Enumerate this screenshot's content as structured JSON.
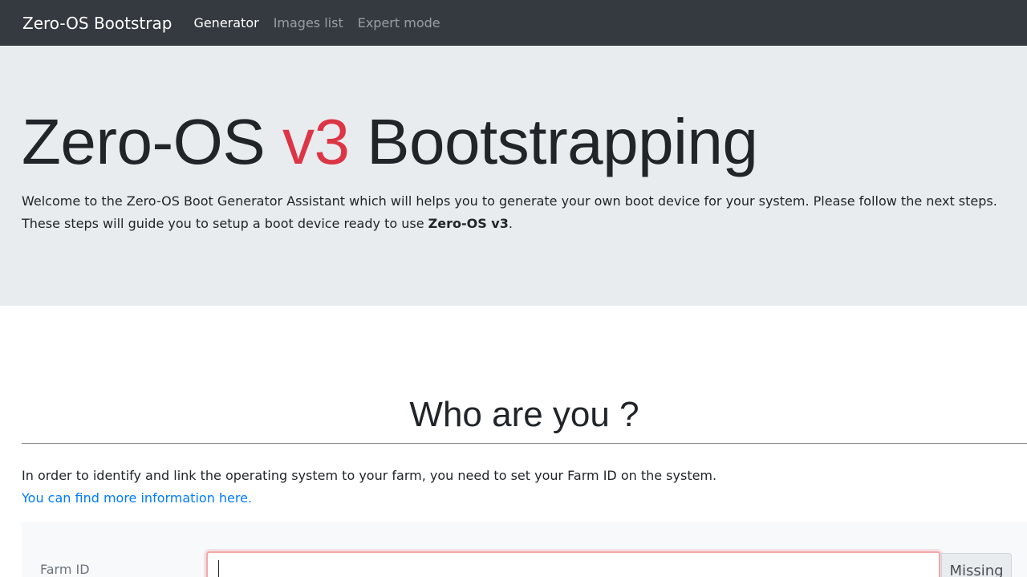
{
  "navbar": {
    "brand": "Zero-OS Bootstrap",
    "links": [
      {
        "label": "Generator",
        "active": true
      },
      {
        "label": "Images list",
        "active": false
      },
      {
        "label": "Expert mode",
        "active": false
      }
    ]
  },
  "hero": {
    "title_prefix": "Zero-OS ",
    "title_accent": "v3",
    "title_suffix": " Bootstrapping",
    "lead_text": "Welcome to the Zero-OS Boot Generator Assistant which will helps you to generate your own boot device for your system. Please follow the next steps. These steps will guide you to setup a boot device ready to use ",
    "lead_bold": "Zero-OS v3",
    "lead_end": "."
  },
  "section": {
    "title": "Who are you ?",
    "description": "In order to identify and link the operating system to your farm, you need to set your Farm ID on the system.",
    "info_link": "You can find more information here."
  },
  "form": {
    "farm_label": "Farm ID",
    "farm_value": "",
    "farm_status": "Missing"
  },
  "colors": {
    "navbar_bg": "#343a40",
    "accent_red": "#dc3545",
    "link_blue": "#007bff",
    "jumbotron_bg": "#e9ecef"
  }
}
